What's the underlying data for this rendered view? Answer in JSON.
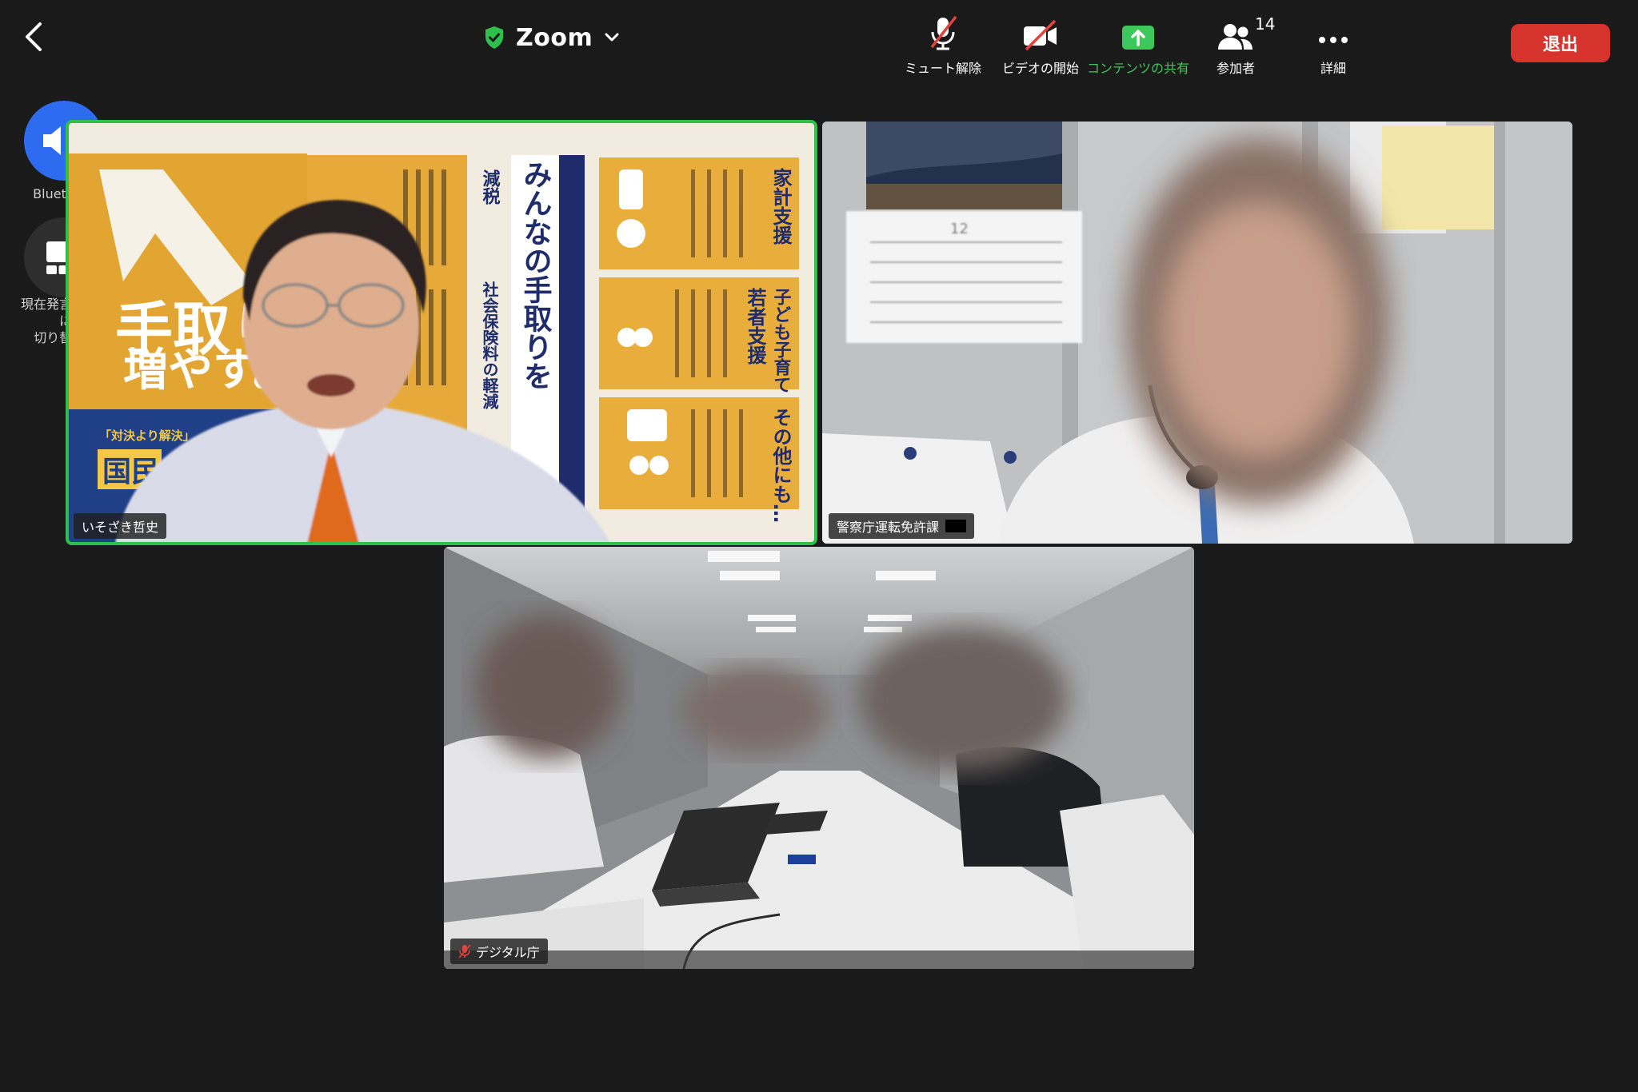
{
  "header": {
    "meeting_title": "Zoom",
    "security_icon": "shield-check-icon",
    "title_dropdown_icon": "chevron-down-icon",
    "back_icon": "chevron-left-icon"
  },
  "toolbar": {
    "unmute_label": "ミュート解除",
    "start_video_label": "ビデオの開始",
    "share_label": "コンテンツの共有",
    "participants_label": "参加者",
    "participants_count": "14",
    "more_label": "詳細",
    "leave_label": "退出"
  },
  "side_controls": {
    "audio_label": "Bluetooth",
    "view_switch_label_line1": "現在発言中の方に",
    "view_switch_label_line2": "切り替える"
  },
  "tiles": [
    {
      "name": "いそざき哲史",
      "active": true,
      "muted": false
    },
    {
      "name": "警察庁運転免許課",
      "active": false,
      "muted": false
    },
    {
      "name": "デジタル庁",
      "active": false,
      "muted": true
    }
  ],
  "poster": {
    "headline_1": "手取り",
    "headline_2": "増やす。",
    "vertical_main": "みんなの手取りを",
    "col_1": "家計支援",
    "col_2": "若者支援",
    "col_3": "子ども子育て",
    "col_4": "その他にも…",
    "col_5": "減税",
    "col_6": "社会保険料の軽減",
    "small_banner": "「対決より解決」",
    "banner_2": "国民"
  },
  "calendar": {
    "month": "12"
  },
  "colors": {
    "background": "#1a1a1a",
    "active_outline": "#2ec04b",
    "leave_button": "#d5332c",
    "audio_button": "#2d6cf0",
    "share_green": "#3cc85a",
    "muted_red": "#e0453c"
  }
}
